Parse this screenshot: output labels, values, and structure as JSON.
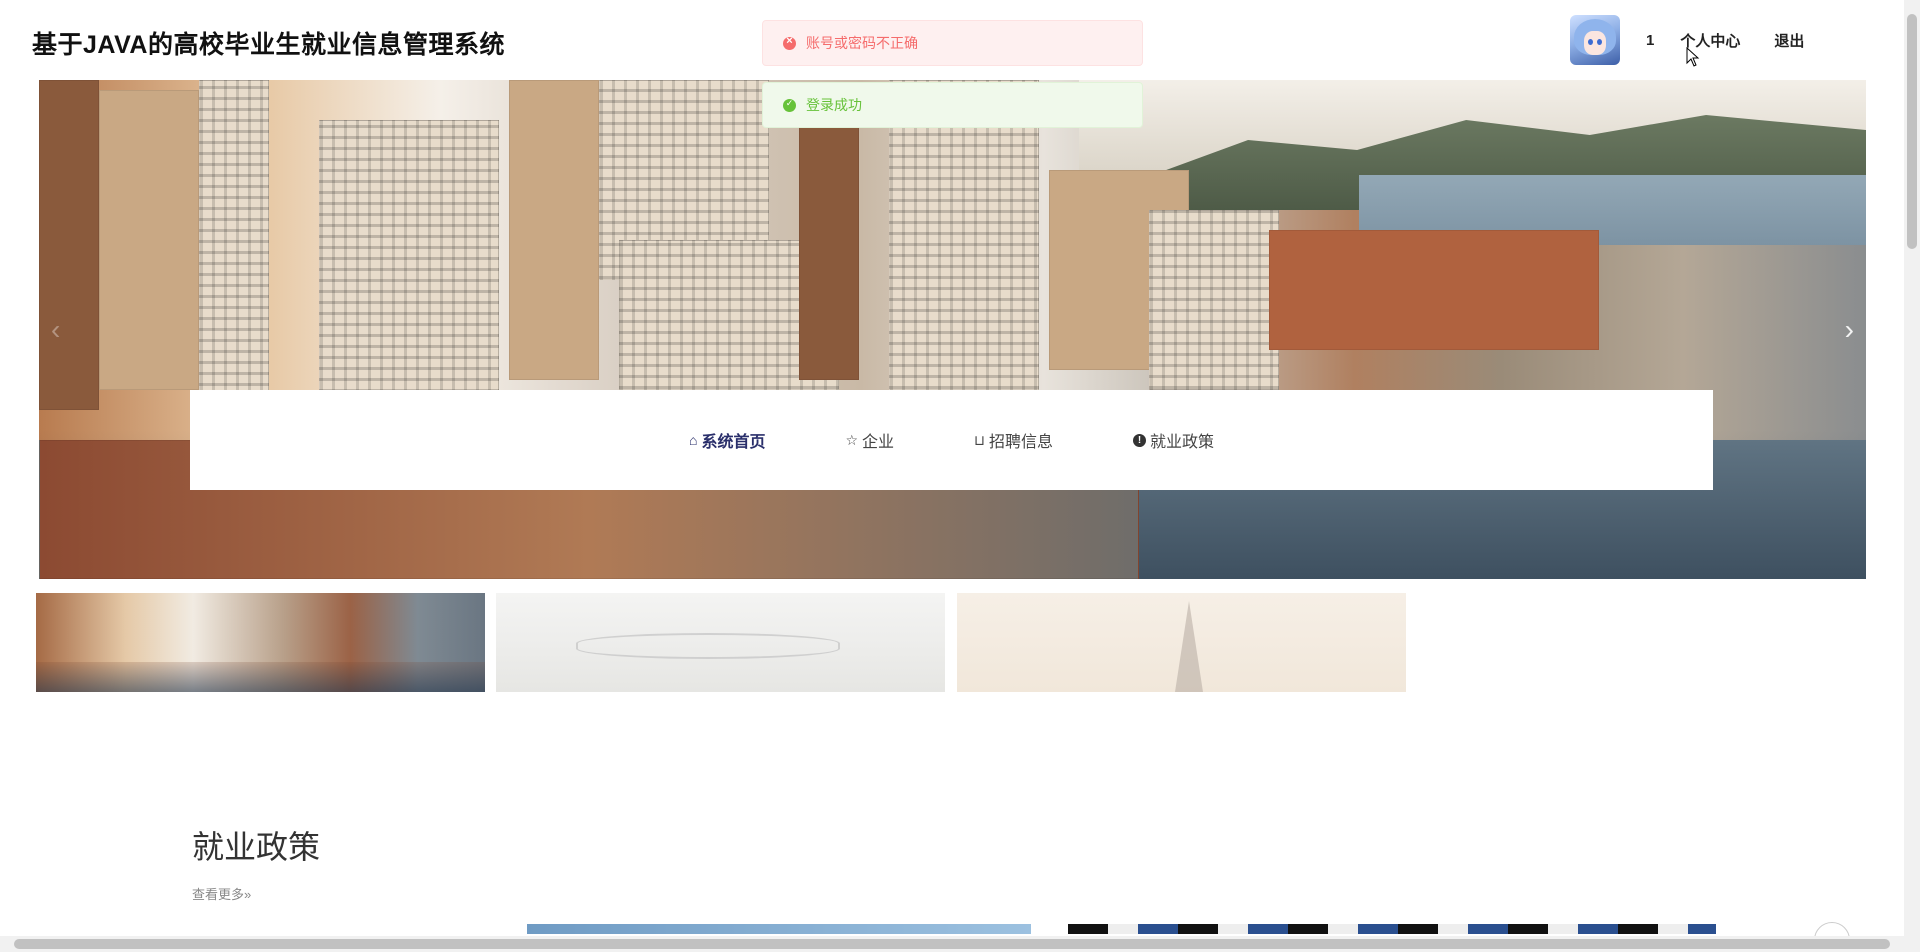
{
  "header": {
    "site_title": "基于JAVA的高校毕业生就业信息管理系统",
    "user_name": "1",
    "profile_label": "个人中心",
    "logout_label": "退出"
  },
  "toasts": {
    "error_message": "账号或密码不正确",
    "success_message": "登录成功"
  },
  "nav": {
    "items": [
      {
        "label": "系统首页",
        "icon": "home-icon",
        "active": true
      },
      {
        "label": "企业",
        "icon": "star-icon",
        "active": false
      },
      {
        "label": "招聘信息",
        "icon": "bag-icon",
        "active": false
      },
      {
        "label": "就业政策",
        "icon": "warning-circle-icon",
        "active": false
      }
    ]
  },
  "banner": {
    "prev_icon": "chevron-left-icon",
    "next_icon": "chevron-right-icon",
    "slide_count": 3
  },
  "section": {
    "title": "就业政策",
    "more_label": "查看更多"
  },
  "colors": {
    "nav_active": "#2a2f6b",
    "error": "#f56c6c",
    "success": "#67c23a"
  }
}
